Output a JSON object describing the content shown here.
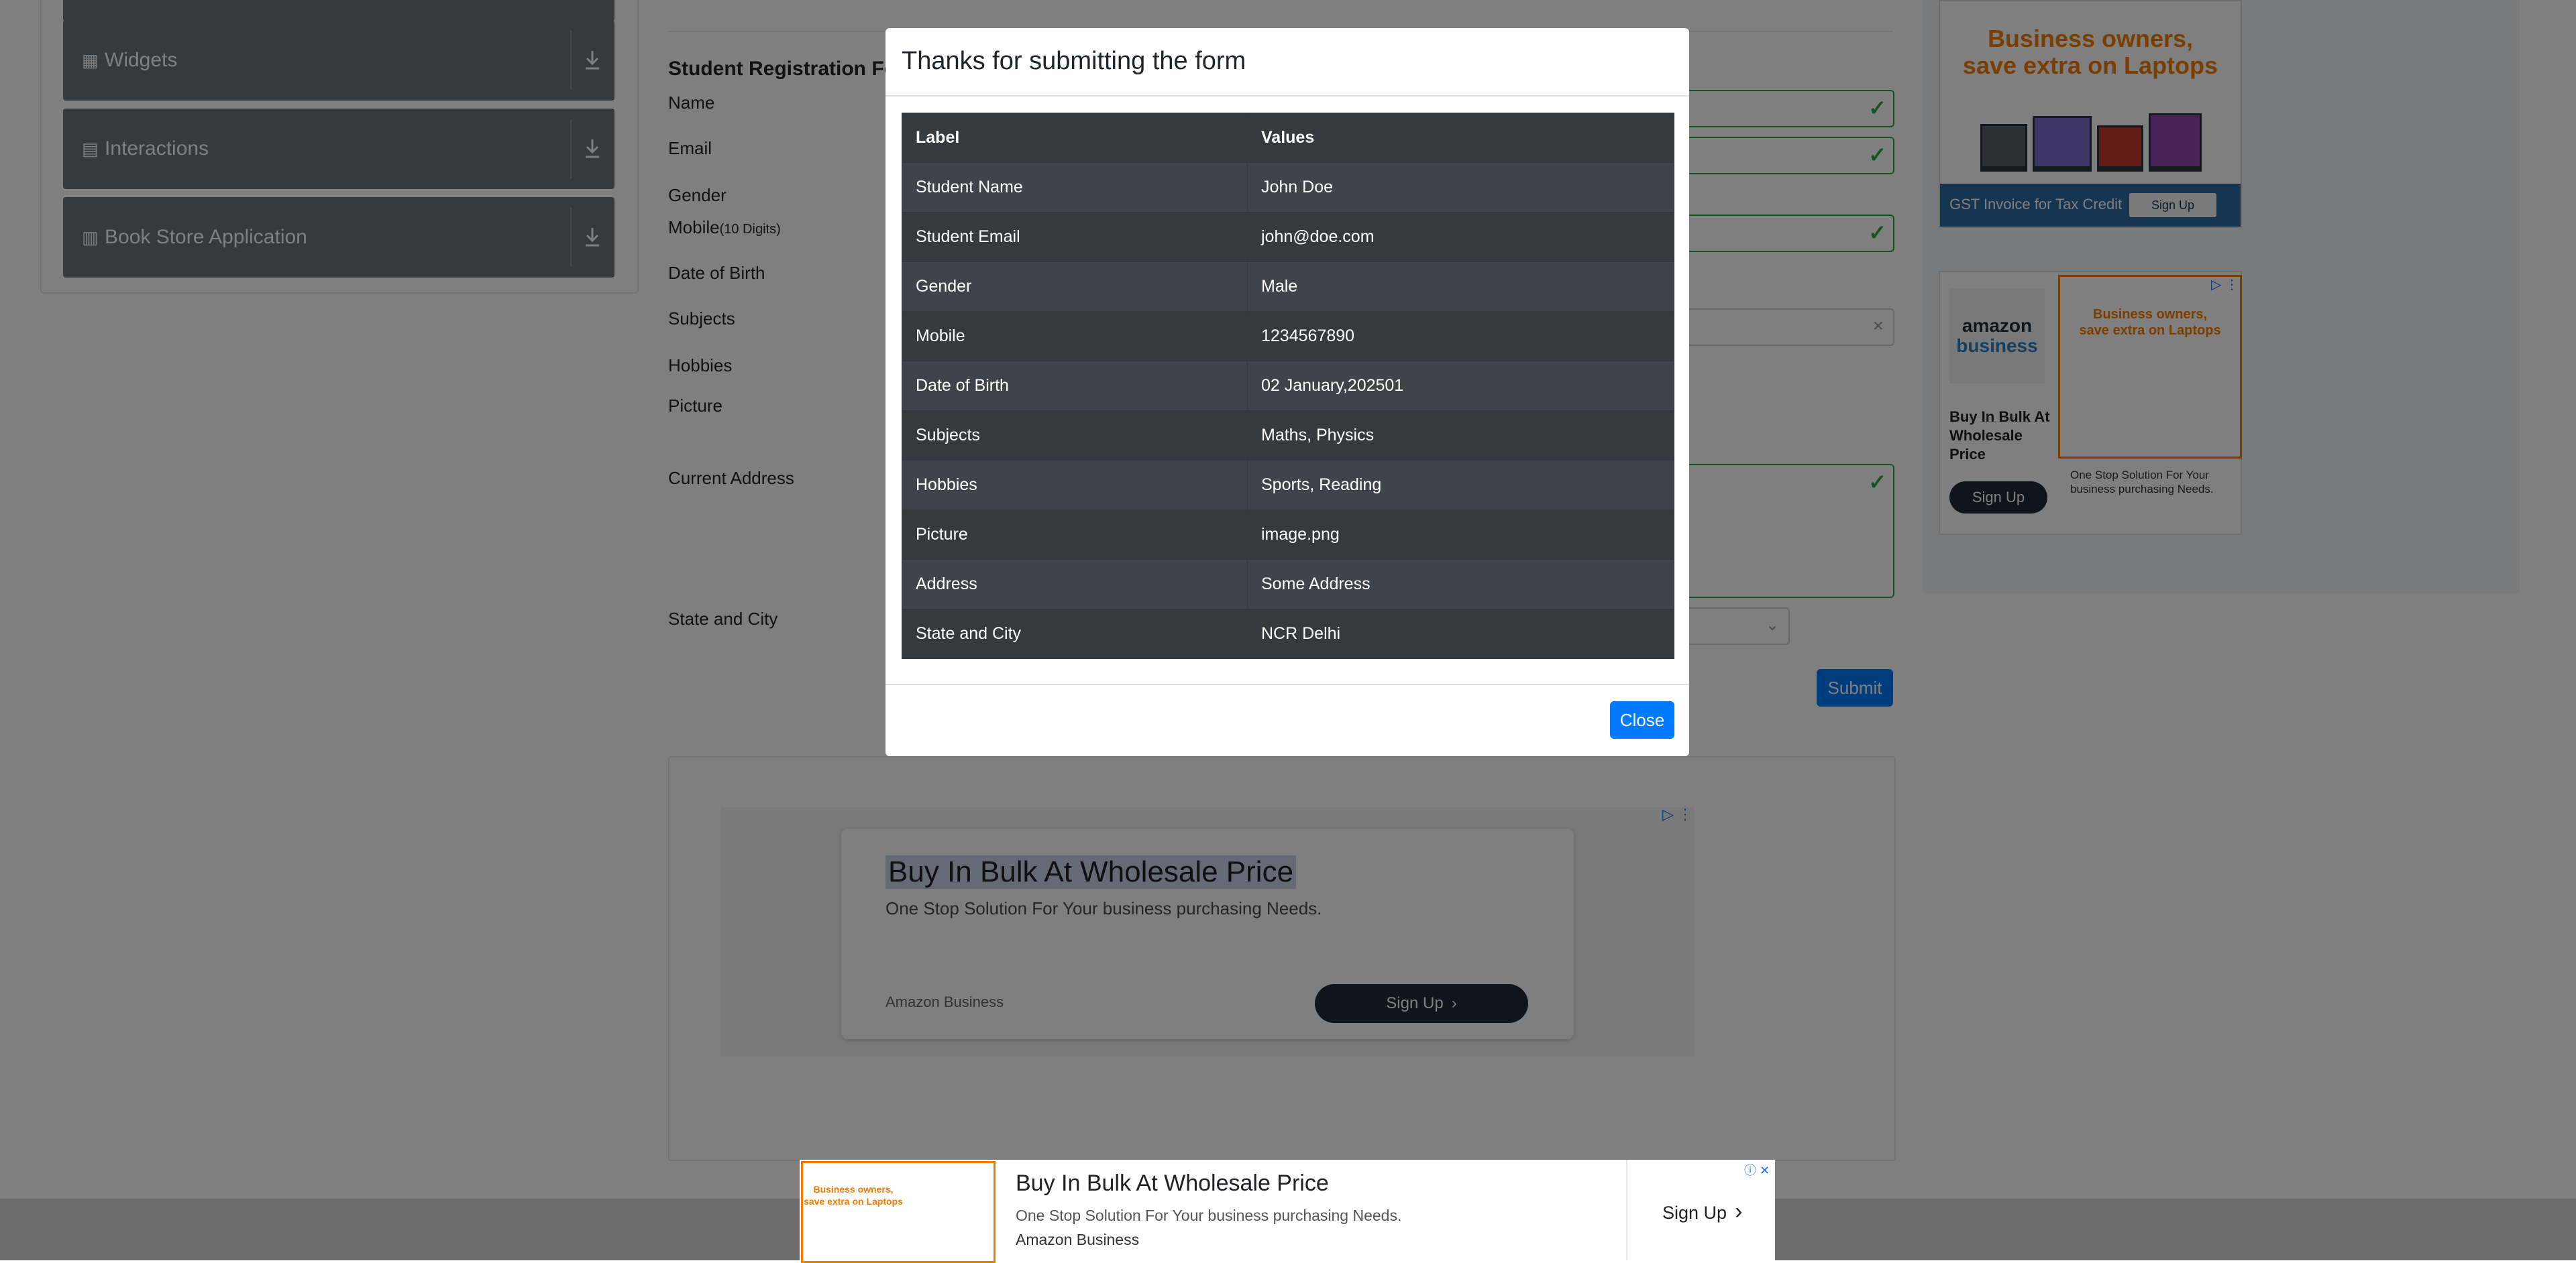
{
  "sidebar": {
    "groups": [
      {
        "label": "Widgets",
        "icon": "widgets-icon"
      },
      {
        "label": "Interactions",
        "icon": "interactions-icon"
      },
      {
        "label": "Book Store Application",
        "icon": "book-store-icon"
      }
    ]
  },
  "form": {
    "title": "Student Registration For",
    "labels": {
      "name": "Name",
      "email": "Email",
      "gender": "Gender",
      "mobile": "Mobile",
      "mobile_hint": "(10 Digits)",
      "dob": "Date of Birth",
      "subjects": "Subjects",
      "hobbies": "Hobbies",
      "picture": "Picture",
      "current_address": "Current Address",
      "state_city": "State and City"
    },
    "submit_label": "Submit"
  },
  "modal": {
    "title": "Thanks for submitting the form",
    "table": {
      "headers": [
        "Label",
        "Values"
      ],
      "rows": [
        [
          "Student Name",
          "John Doe"
        ],
        [
          "Student Email",
          "john@doe.com"
        ],
        [
          "Gender",
          "Male"
        ],
        [
          "Mobile",
          "1234567890"
        ],
        [
          "Date of Birth",
          "02 January,202501"
        ],
        [
          "Subjects",
          "Maths, Physics"
        ],
        [
          "Hobbies",
          "Sports, Reading"
        ],
        [
          "Picture",
          "image.png"
        ],
        [
          "Address",
          "Some Address"
        ],
        [
          "State and City",
          "NCR Delhi"
        ]
      ]
    },
    "close_label": "Close"
  },
  "ads": {
    "top_right": {
      "headline": "Business owners,\nsave extra on Laptops",
      "strip_text": "GST Invoice for Tax Credit",
      "strip_button": "Sign Up"
    },
    "side": {
      "logo_line1": "amazon",
      "logo_line2": "business",
      "title": "Buy In Bulk At Wholesale Price",
      "button": "Sign Up",
      "image_headline": "Business owners,\nsave extra on Laptops",
      "description": "One Stop Solution For Your business purchasing Needs."
    },
    "center": {
      "title": "Buy In Bulk At Wholesale Price",
      "subtitle": "One Stop Solution For Your business purchasing Needs.",
      "brand": "Amazon Business",
      "button": "Sign Up"
    },
    "bottom": {
      "image_headline": "Business owners,\nsave extra on Laptops",
      "title": "Buy In Bulk At Wholesale Price",
      "subtitle": "One Stop Solution For Your business purchasing Needs.",
      "brand": "Amazon Business",
      "button": "Sign Up"
    }
  },
  "colors": {
    "primary": "#007bff",
    "success": "#28a745",
    "table_dark": "#343a40",
    "ad_accent": "#f57c00"
  }
}
